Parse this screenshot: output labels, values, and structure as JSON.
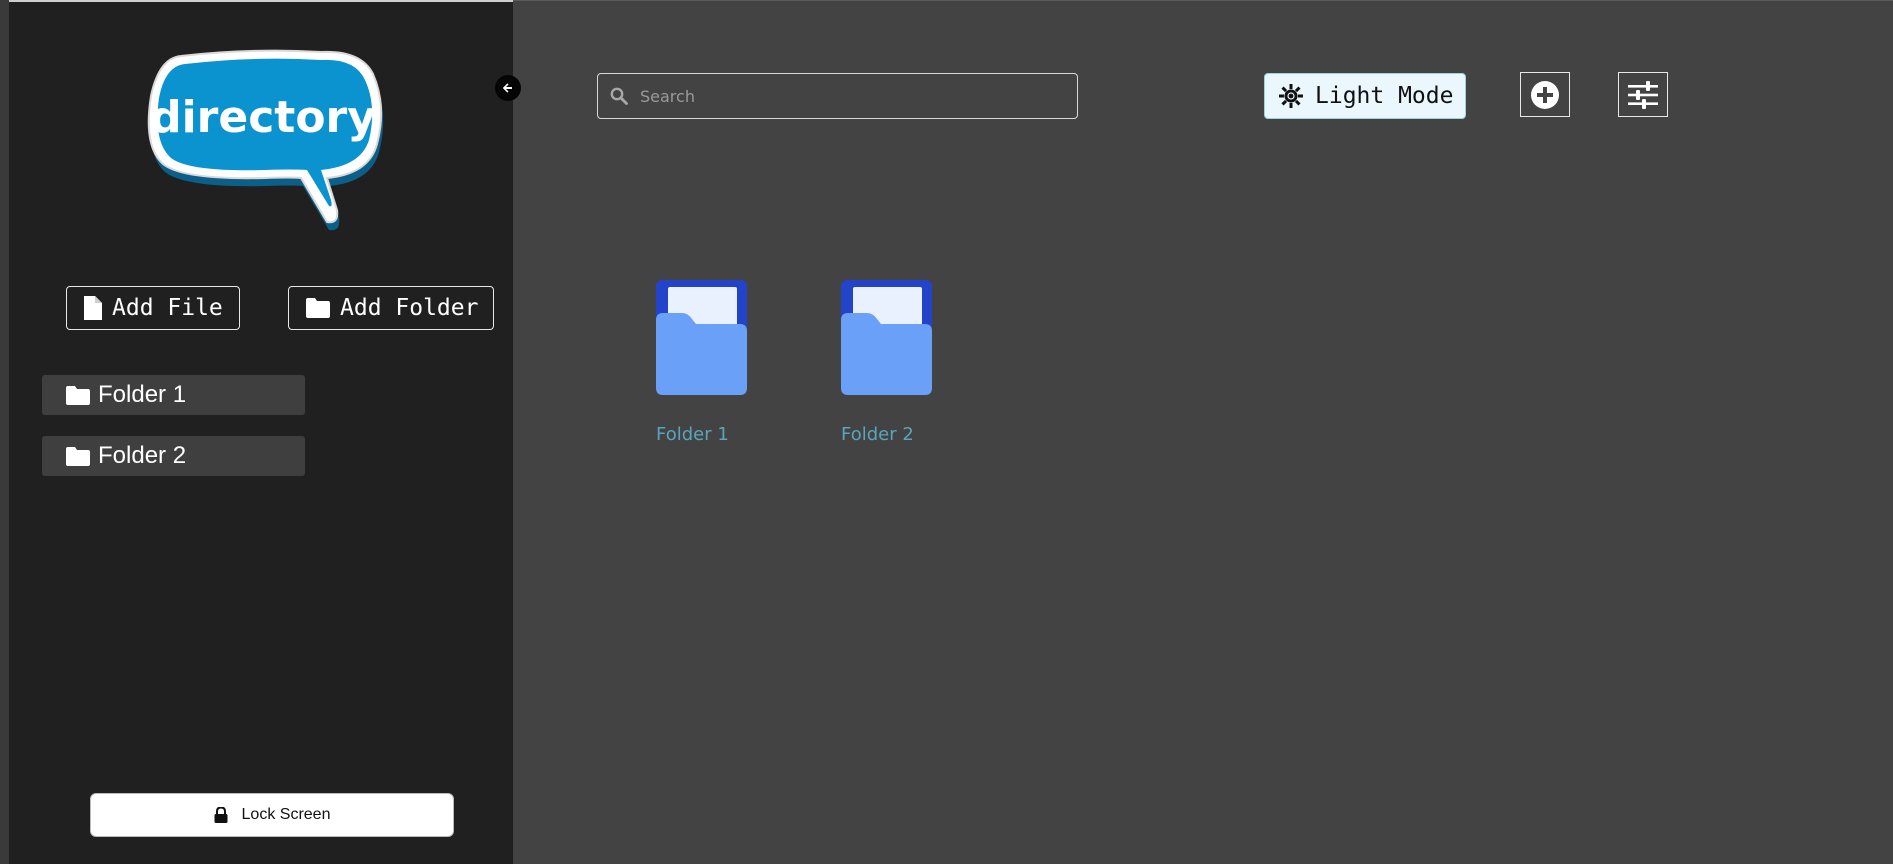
{
  "sidebar": {
    "logo_text": "directory",
    "add_file_label": "Add File",
    "add_folder_label": "Add Folder",
    "folders": [
      {
        "label": "Folder 1"
      },
      {
        "label": "Folder 2"
      }
    ],
    "lock_label": "Lock Screen"
  },
  "toolbar": {
    "search_placeholder": "Search",
    "light_mode_label": "Light Mode"
  },
  "main": {
    "folders": [
      {
        "label": "Folder 1"
      },
      {
        "label": "Folder 2"
      }
    ]
  },
  "icons": {
    "collapse": "arrow-left-circle-icon",
    "file": "file-icon",
    "folder": "folder-icon",
    "lock": "lock-icon",
    "search": "search-icon",
    "sun": "sun-icon",
    "add": "plus-circle-icon",
    "settings": "sliders-icon"
  },
  "colors": {
    "sidebar_bg": "#202020",
    "main_bg": "#434343",
    "logo_bubble": "#0b93d0",
    "folder_front": "#6aa0f8",
    "folder_back": "#2344c8",
    "folder_label": "#5ba4bd",
    "light_mode_bg": "#eaf7fc"
  }
}
